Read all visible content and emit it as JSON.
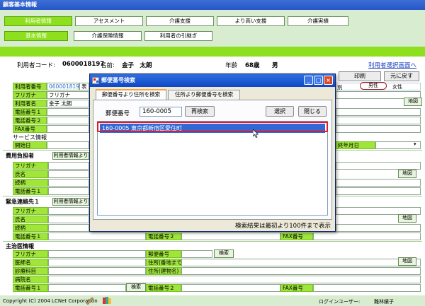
{
  "window": {
    "title": "顧客基本情報"
  },
  "nav": {
    "row1": [
      "利用者情報",
      "アセスメント",
      "介護支援",
      "より高い支援",
      "介護実績"
    ],
    "row2": [
      "基本情報",
      "介護保険情報",
      "利用者の引継ぎ"
    ]
  },
  "user": {
    "code_label": "利用者コード:",
    "code": "0600018197",
    "name_label": "名前:",
    "name": "金子　太朗",
    "age_label": "年齢",
    "age": "68歳",
    "gender": "男",
    "back_link": "利用者選択画面へ"
  },
  "form": {
    "user_no_label": "利用者番号",
    "user_no": "0600018197",
    "user_no_suffix": "表",
    "furigana_label": "フリガナ",
    "furigana": "フリガナ",
    "name_label": "利用者名",
    "name": "金子 太朗",
    "phone1_label": "電話番号１",
    "phone2_label": "電話番号２",
    "fax_label": "FAX番号",
    "service_label": "サービス情報",
    "start_label": "開始日",
    "print": "印刷",
    "back": "元に戻す",
    "gender_suffix": "別",
    "male": "男性",
    "female": "女性",
    "map": "地図",
    "end_date_label": "終年月日",
    "payer_title": "費用負担者",
    "copy_user_info": "利用者情報より",
    "shimei": "氏名",
    "zokugara": "続柄",
    "phone1": "電話番号１",
    "phone2": "電話番号２",
    "fax": "FAX番号",
    "emergency_title": "緊急連絡先１",
    "doctor_title": "主治医情報",
    "doctor_name_label": "医師名",
    "dept_label": "診療科目",
    "hospital_label": "病院名",
    "zip_label": "郵便番号",
    "search": "検索",
    "addr1_label": "住所(番地まで)",
    "addr2_label": "住所(建物名)"
  },
  "dialog": {
    "title": "郵便番号検索",
    "tab1": "郵便番号より住所を検索",
    "tab2": "住所より郵便番号を検索",
    "zip_label": "郵便番号",
    "zip_value": "160-0005",
    "research": "再検索",
    "select": "選択",
    "close": "閉じる",
    "result": "160-0005 東京都新宿区愛住町",
    "status": "検索結果は最初より100件まで表示"
  },
  "footer": {
    "copyright": "Copyright (C) 2004 LCNet Corporation",
    "login_label": "ログインユーザー:",
    "login_user": "難林績子"
  }
}
